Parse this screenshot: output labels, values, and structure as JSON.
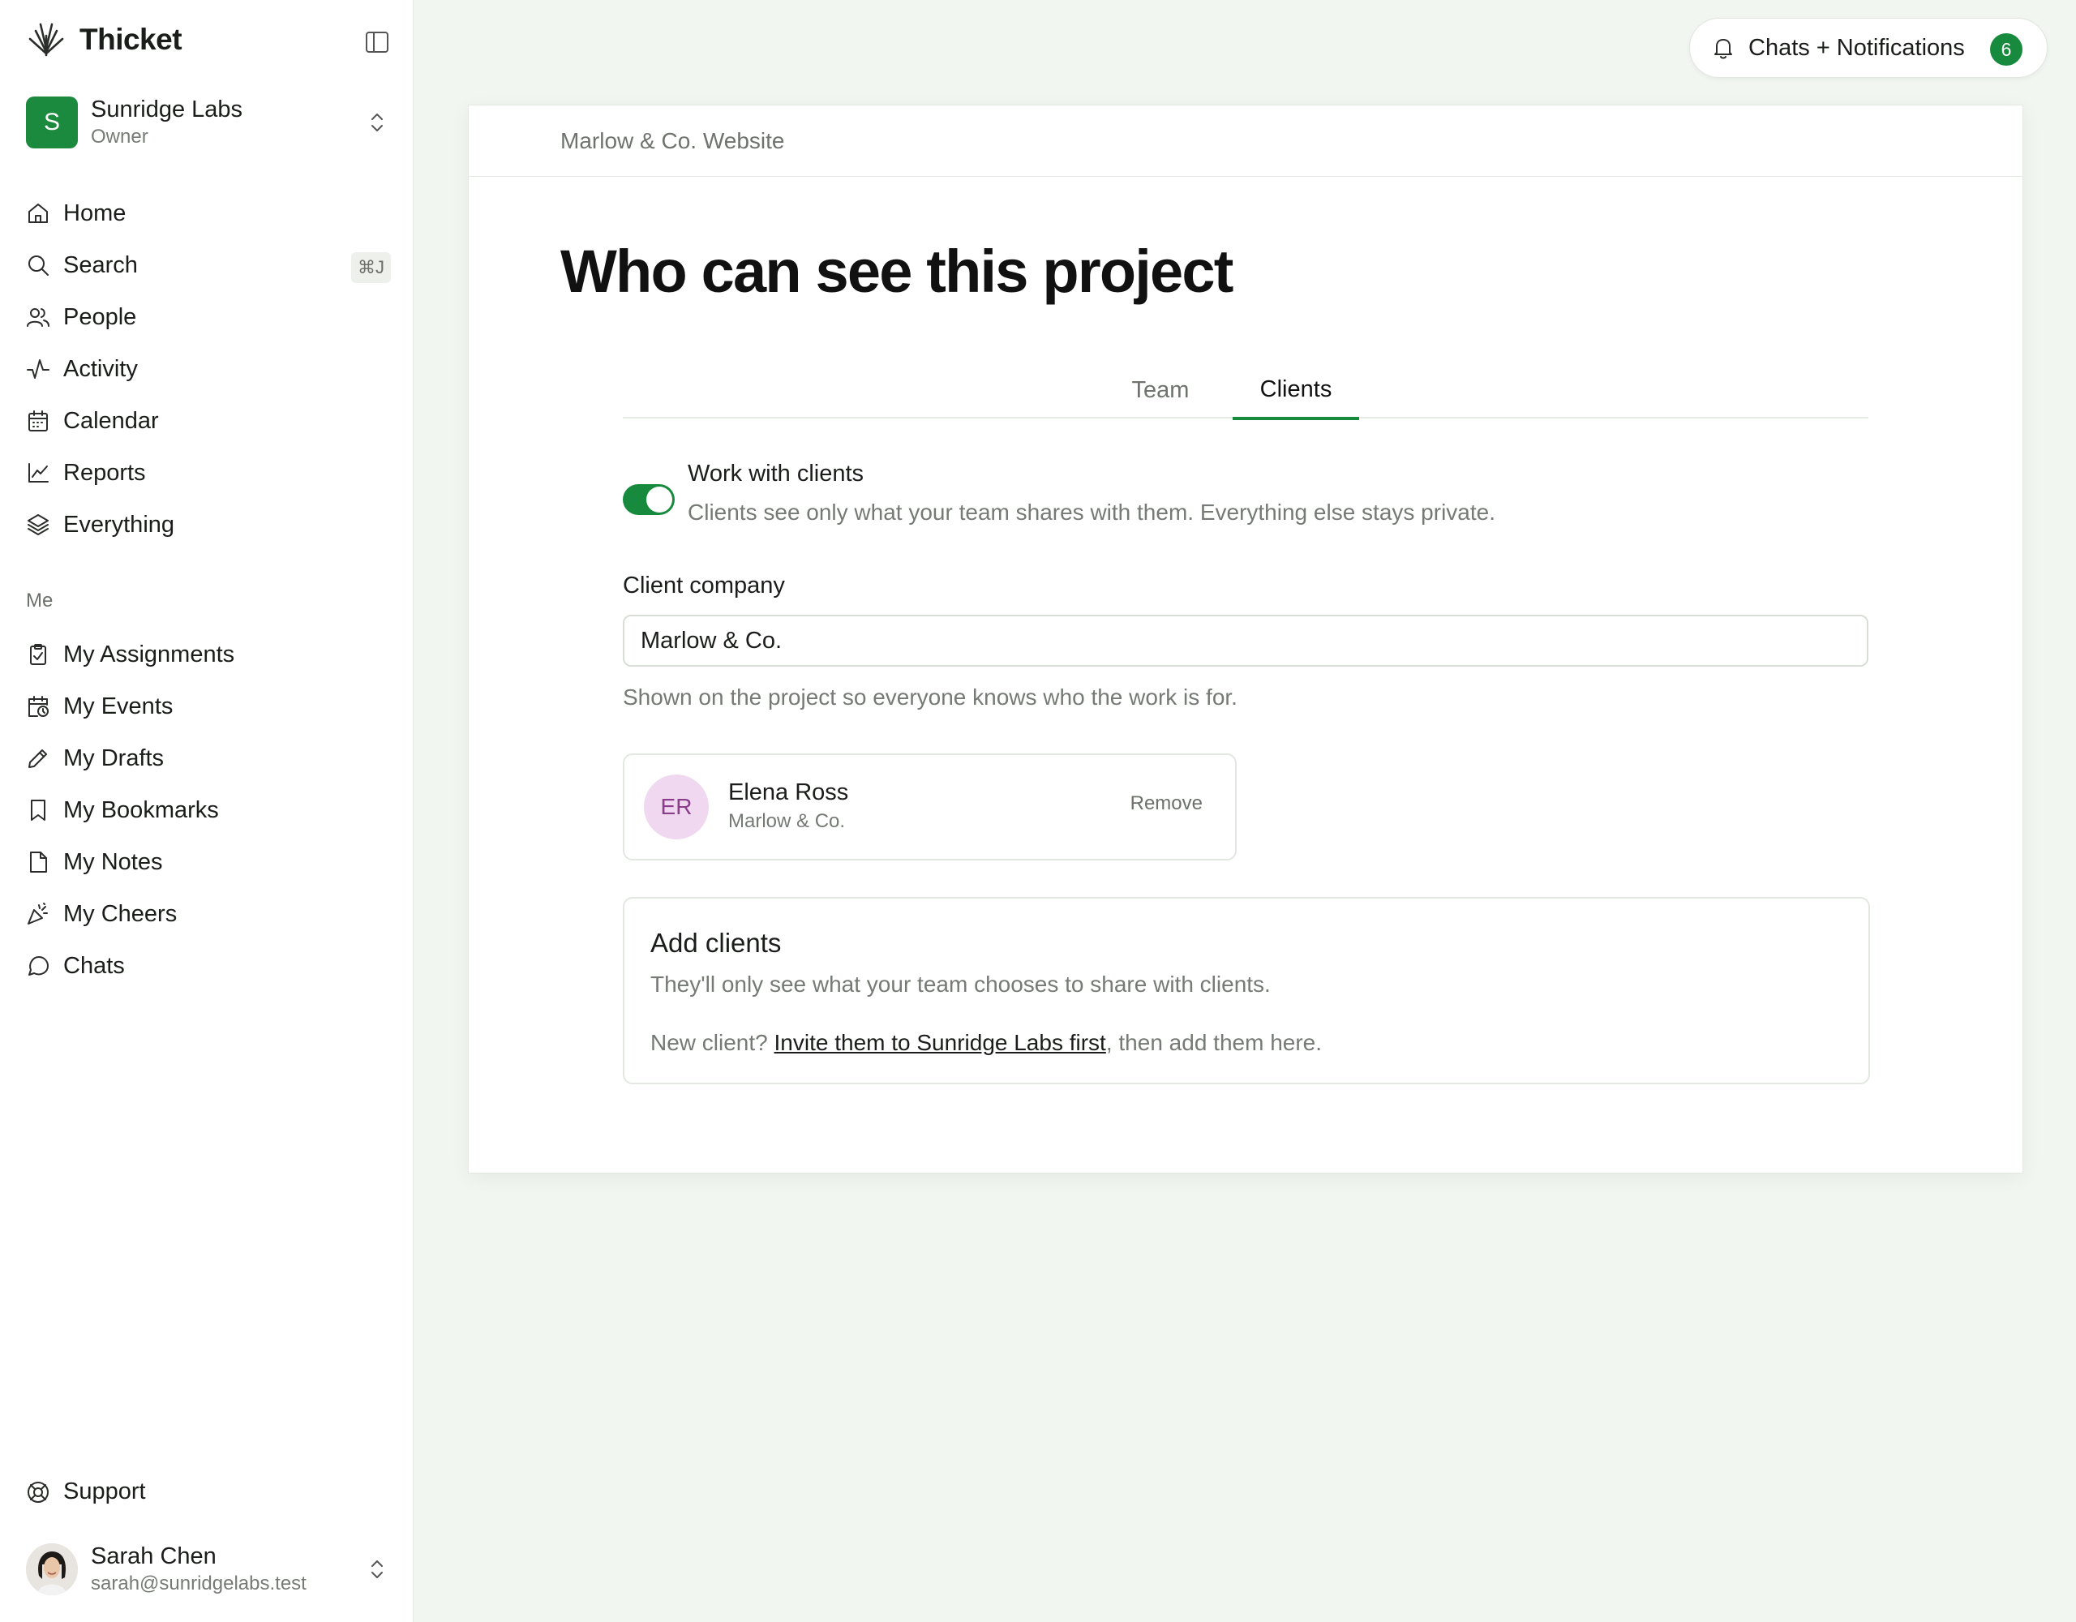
{
  "app": {
    "name": "Thicket"
  },
  "workspace": {
    "initial": "S",
    "name": "Sunridge Labs",
    "role": "Owner",
    "color": "#1b8a3e"
  },
  "nav": {
    "primary": [
      {
        "label": "Home",
        "icon": "home-icon"
      },
      {
        "label": "Search",
        "icon": "search-icon",
        "shortcut": "⌘J"
      },
      {
        "label": "People",
        "icon": "people-icon"
      },
      {
        "label": "Activity",
        "icon": "activity-icon"
      },
      {
        "label": "Calendar",
        "icon": "calendar-icon"
      },
      {
        "label": "Reports",
        "icon": "chart-icon"
      },
      {
        "label": "Everything",
        "icon": "layers-icon"
      }
    ],
    "section_label": "Me",
    "me": [
      {
        "label": "My Assignments",
        "icon": "clipboard-check-icon"
      },
      {
        "label": "My Events",
        "icon": "calendar-clock-icon"
      },
      {
        "label": "My Drafts",
        "icon": "pencil-icon"
      },
      {
        "label": "My Bookmarks",
        "icon": "bookmark-icon"
      },
      {
        "label": "My Notes",
        "icon": "note-icon"
      },
      {
        "label": "My Cheers",
        "icon": "party-popper-icon"
      },
      {
        "label": "Chats",
        "icon": "chat-bubble-icon"
      }
    ],
    "support": "Support"
  },
  "user": {
    "name": "Sarah Chen",
    "email": "sarah@sunridgelabs.test"
  },
  "notifications": {
    "label": "Chats + Notifications",
    "count": "6"
  },
  "project": {
    "breadcrumb": "Marlow & Co. Website",
    "title": "Who can see this project"
  },
  "tabs": {
    "team": "Team",
    "clients": "Clients",
    "active": "Clients"
  },
  "clients": {
    "toggle": {
      "title": "Work with clients",
      "description": "Clients see only what your team shares with them. Everything else stays private.",
      "enabled": true
    },
    "company_label": "Client company",
    "company_value": "Marlow & Co.",
    "company_help": "Shown on the project so everyone knows who the work is for.",
    "members": [
      {
        "initials": "ER",
        "name": "Elena Ross",
        "company": "Marlow & Co.",
        "action": "Remove"
      }
    ],
    "add": {
      "title": "Add clients",
      "description": "They'll only see what your team chooses to share with clients.",
      "prefix": "New client? ",
      "link": "Invite them to Sunridge Labs first",
      "suffix": ", then add them here."
    }
  },
  "colors": {
    "accent": "#178a3d",
    "page_background": "#f1f6f0",
    "member_avatar_bg": "#f0d9f0"
  }
}
